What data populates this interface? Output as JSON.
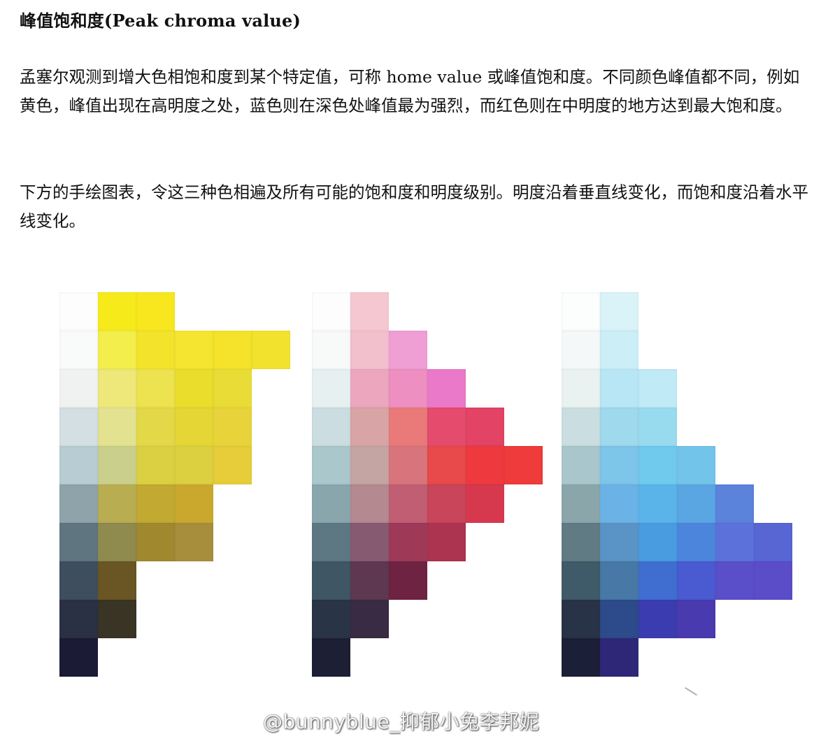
{
  "heading": "峰值饱和度(Peak chroma value)",
  "paragraphs": [
    "孟塞尔观测到增大色相饱和度到某个特定值，可称 home value 或峰值饱和度。不同颜色峰值都不同，例如黄色，峰值出现在高明度之处，蓝色则在深色处峰值最为强烈，而红色则在中明度的地方达到最大饱和度。",
    "下方的手绘图表，令这三种色相遍及所有可能的饱和度和明度级别。明度沿着垂直线变化，而饱和度沿着水平线变化。"
  ],
  "watermark": "@bunnyblue_抑郁小兔李邦妮",
  "charts": [
    {
      "hue": "yellow",
      "rows": [
        [
          "#fdfdfd",
          "#f7ea1a",
          "#f8e71e"
        ],
        [
          "#f9fafa",
          "#f3ee4c",
          "#f3e32b",
          "#f5e530",
          "#f4e32a",
          "#f2e22e"
        ],
        [
          "#f0f2f1",
          "#eee77a",
          "#ede24f",
          "#ebdd2c",
          "#eadc36"
        ],
        [
          "#d3dfe2",
          "#e2e291",
          "#e2d848",
          "#e5d635",
          "#e8d43a"
        ],
        [
          "#b7ccd3",
          "#cad08b",
          "#dbd042",
          "#dcd041",
          "#e6cd39"
        ],
        [
          "#8fa3ab",
          "#b9ad52",
          "#c2a931",
          "#caa82e"
        ],
        [
          "#5f7580",
          "#8f8a4d",
          "#a0882f",
          "#a78e3c"
        ],
        [
          "#3f4e5e",
          "#6a5524",
          "#ffffff"
        ],
        [
          "#2a3145",
          "#3a3425"
        ],
        [
          "#1c1b35"
        ]
      ]
    },
    {
      "hue": "red",
      "rows": [
        [
          "#fdfdfd",
          "#f5c8d1"
        ],
        [
          "#f8f9f9",
          "#f2bfcd",
          "#ef9fd4"
        ],
        [
          "#e7f0f1",
          "#eca6be",
          "#ee8fc1",
          "#eb79c9"
        ],
        [
          "#cbdde0",
          "#d9a4a5",
          "#ea7a7a",
          "#e54b6c",
          "#e34364"
        ],
        [
          "#aac7cc",
          "#c5a5a3",
          "#d8757c",
          "#e8494a",
          "#ee3a3f",
          "#ef3b3b"
        ],
        [
          "#8aa6ad",
          "#b48990",
          "#c25e73",
          "#c9455a",
          "#d6394e"
        ],
        [
          "#5e7883",
          "#865b72",
          "#9e3a58",
          "#ac3451"
        ],
        [
          "#3f5664",
          "#5d3850",
          "#6f2342"
        ],
        [
          "#2a3447",
          "#3a2b44"
        ],
        [
          "#1d1f35"
        ]
      ]
    },
    {
      "hue": "blue",
      "rows": [
        [
          "#fcfdfd",
          "#d9f3f8"
        ],
        [
          "#f5f8f8",
          "#cbeef7"
        ],
        [
          "#e9f1f1",
          "#b8e6f4",
          "#bfeaf6"
        ],
        [
          "#cadee1",
          "#9fd9ee",
          "#98dbef"
        ],
        [
          "#a9c6cc",
          "#7ec5ea",
          "#6fcaee",
          "#73c4ea"
        ],
        [
          "#8aa6ab",
          "#6bb3e6",
          "#5ab4ea",
          "#5aa6e3",
          "#5b83dc"
        ],
        [
          "#607b84",
          "#5a94c7",
          "#4a9ce0",
          "#4c86dc",
          "#5c72da",
          "#5866d4"
        ],
        [
          "#3f5a68",
          "#4778a6",
          "#3f6ed0",
          "#4a5ad0",
          "#5a4fc8",
          "#5b4dc8"
        ],
        [
          "#283347",
          "#2d4a8a",
          "#3b3cb0",
          "#4a3ab0"
        ],
        [
          "#1c1f38",
          "#2e2777"
        ]
      ]
    }
  ]
}
